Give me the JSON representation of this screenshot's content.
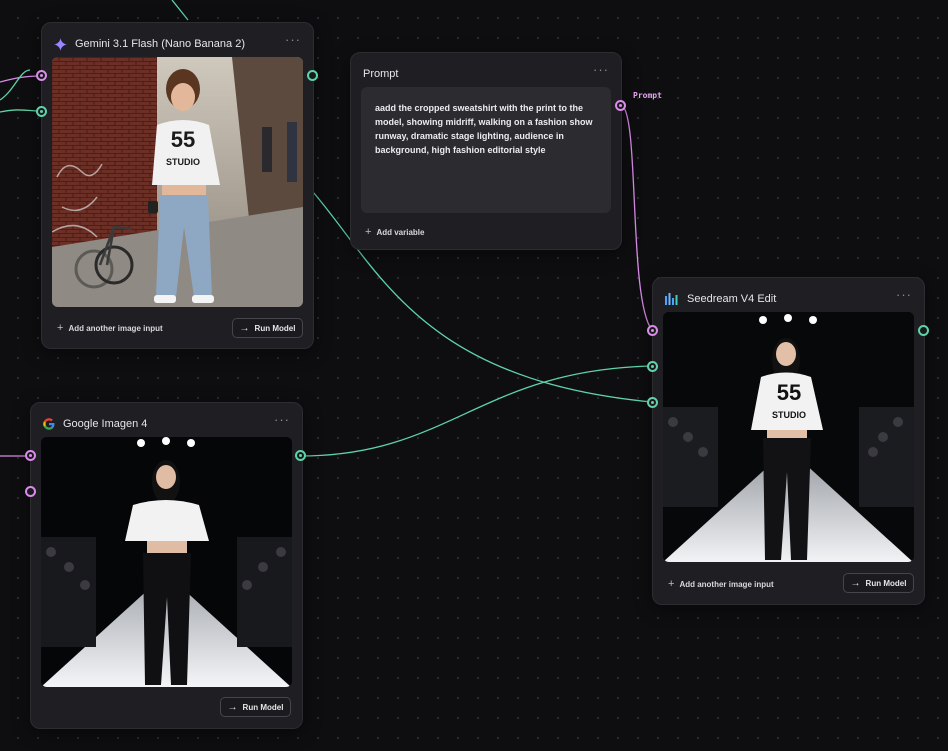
{
  "nodes": {
    "gemini": {
      "title": "Gemini 3.1 Flash (Nano Banana 2)",
      "more": "···",
      "image": {
        "shirt_number": "55",
        "shirt_text": "STUDIO"
      },
      "add_input_label": "Add another image input",
      "run_label": "Run Model"
    },
    "prompt": {
      "title": "Prompt",
      "more": "···",
      "text": "aadd the cropped sweatshirt with the print to the model, showing midriff, walking on a fashion show runway, dramatic stage lighting, audience in background, high fashion editorial style",
      "add_variable_label": "Add variable",
      "output_label": "Prompt"
    },
    "seedream": {
      "title": "Seedream V4 Edit",
      "more": "···",
      "image": {
        "shirt_number": "55",
        "shirt_text": "STUDIO"
      },
      "add_input_label": "Add another image input",
      "run_label": "Run Model"
    },
    "imagen": {
      "title": "Google Imagen 4",
      "more": "···",
      "run_label": "Run Model"
    }
  },
  "colors": {
    "wire_green": "#5fd3a8",
    "wire_pink": "#d98ce8",
    "node_bg": "#1f1f23",
    "canvas_bg": "#0e0e10"
  },
  "icons": {
    "gemini": "sparkle-icon",
    "imagen": "google-g-icon",
    "seedream": "bar-chart-icon",
    "run": "arrow-right-icon",
    "add": "plus-icon",
    "more": "more-horizontal-icon"
  }
}
